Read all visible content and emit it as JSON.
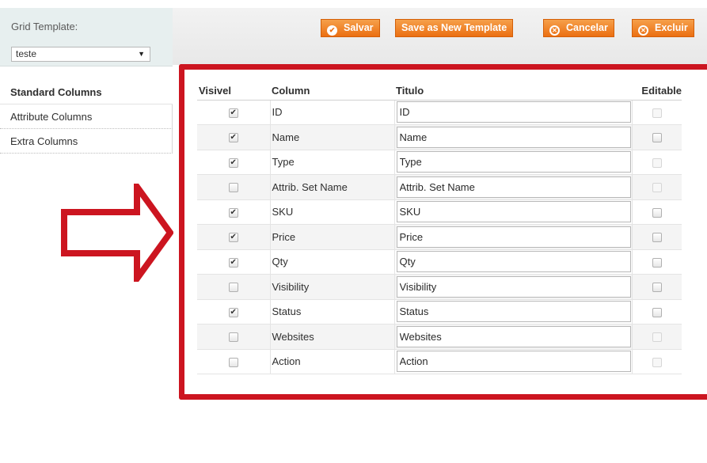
{
  "sidebar": {
    "template_label": "Grid Template:",
    "template_value": "teste",
    "tabs": [
      "Standard Columns",
      "Attribute Columns",
      "Extra Columns"
    ]
  },
  "toolbar": {
    "save": "Salvar",
    "save_new": "Save as New Template",
    "cancel": "Cancelar",
    "delete": "Excluir"
  },
  "grid": {
    "headers": {
      "visible": "Visivel",
      "column": "Column",
      "title": "Titulo",
      "editable": "Editable"
    },
    "rows": [
      {
        "column": "ID",
        "title": "ID",
        "visible": true,
        "editable_enabled": false
      },
      {
        "column": "Name",
        "title": "Name",
        "visible": true,
        "editable_enabled": true
      },
      {
        "column": "Type",
        "title": "Type",
        "visible": true,
        "editable_enabled": false
      },
      {
        "column": "Attrib. Set Name",
        "title": "Attrib. Set Name",
        "visible": false,
        "editable_enabled": false
      },
      {
        "column": "SKU",
        "title": "SKU",
        "visible": true,
        "editable_enabled": true
      },
      {
        "column": "Price",
        "title": "Price",
        "visible": true,
        "editable_enabled": true
      },
      {
        "column": "Qty",
        "title": "Qty",
        "visible": true,
        "editable_enabled": true
      },
      {
        "column": "Visibility",
        "title": "Visibility",
        "visible": false,
        "editable_enabled": true
      },
      {
        "column": "Status",
        "title": "Status",
        "visible": true,
        "editable_enabled": true
      },
      {
        "column": "Websites",
        "title": "Websites",
        "visible": false,
        "editable_enabled": false
      },
      {
        "column": "Action",
        "title": "Action",
        "visible": false,
        "editable_enabled": false
      }
    ]
  },
  "colors": {
    "accent": "#eb6f12",
    "highlight": "#cc1520"
  }
}
